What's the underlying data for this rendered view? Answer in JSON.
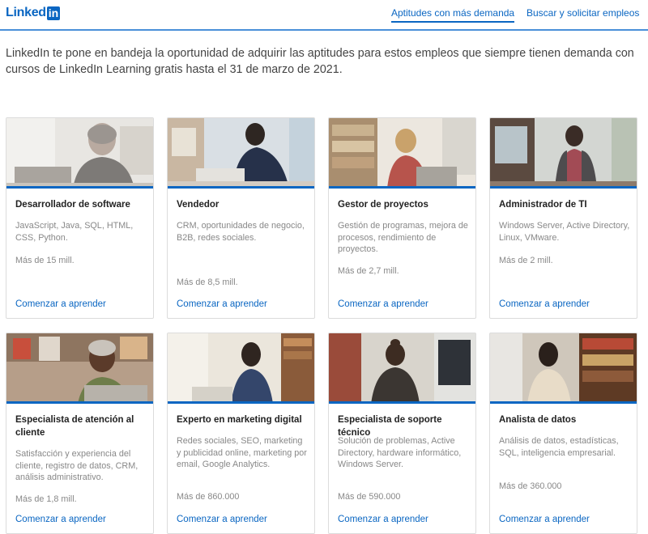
{
  "header": {
    "logo_text": "Linked",
    "logo_box": "in",
    "nav": [
      {
        "label": "Aptitudes con más demanda"
      },
      {
        "label": "Buscar y solicitar empleos"
      }
    ]
  },
  "intro_text": "LinkedIn te pone en bandeja la oportunidad de adquirir las aptitudes para estos empleos que siempre tienen demanda con cursos de LinkedIn Learning gratis hasta el 31 de marzo de 2021.",
  "cards": [
    {
      "title": "Desarrollador de software",
      "skills": "JavaScript, Java, SQL, HTML, CSS, Python.",
      "count": "Más de 15 mill.",
      "link": "Comenzar a aprender"
    },
    {
      "title": "Vendedor",
      "skills": "CRM, oportunidades de negocio, B2B, redes sociales.",
      "count": "Más de 8,5 mill.",
      "link": "Comenzar a aprender"
    },
    {
      "title": "Gestor de proyectos",
      "skills": "Gestión de programas, mejora de procesos, rendimiento de proyectos.",
      "count": "Más de 2,7 mill.",
      "link": "Comenzar a aprender"
    },
    {
      "title": "Administrador de TI",
      "skills": "Windows Server, Active Directory, Linux, VMware.",
      "count": "Más de 2 mill.",
      "link": "Comenzar a aprender"
    },
    {
      "title": "Especialista de atención al cliente",
      "skills": "Satisfacción y experiencia del cliente, registro de datos, CRM, análisis administrativo.",
      "count": "Más de 1,8 mill.",
      "link": "Comenzar a aprender"
    },
    {
      "title": "Experto en marketing digital",
      "skills": "Redes sociales, SEO, marketing y publicidad online, marketing por email, Google Analytics.",
      "count": "Más de 860.000",
      "link": "Comenzar a aprender"
    },
    {
      "title": "Especialista de soporte técnico",
      "skills": "Solución de problemas, Active Directory, hardware informático, Windows Server.",
      "count": "Más de 590.000",
      "link": "Comenzar a aprender"
    },
    {
      "title": "Analista de datos",
      "skills": "Análisis de datos, estadísticas, SQL, inteligencia empresarial.",
      "count": "Más de 360.000",
      "link": "Comenzar a aprender"
    }
  ],
  "colors": {
    "accent": "#0a66c2",
    "divider": "#4a90d9"
  }
}
